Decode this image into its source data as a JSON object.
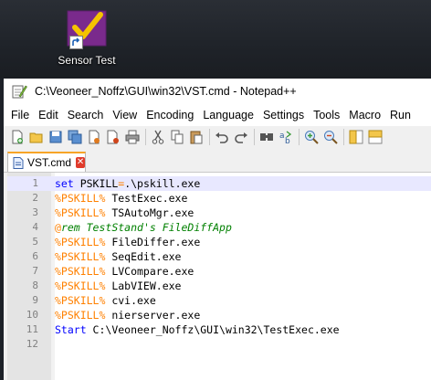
{
  "desktop": {
    "shortcut_label": "Sensor Test"
  },
  "window": {
    "title": "C:\\Veoneer_Noffz\\GUI\\win32\\VST.cmd - Notepad++"
  },
  "menubar": {
    "items": [
      "File",
      "Edit",
      "Search",
      "View",
      "Encoding",
      "Language",
      "Settings",
      "Tools",
      "Macro",
      "Run"
    ]
  },
  "toolbar": {
    "buttons": [
      "new-file-icon",
      "open-file-icon",
      "save-icon",
      "save-all-icon",
      "close-icon",
      "close-all-icon",
      "print-icon",
      "cut-icon",
      "copy-icon",
      "paste-icon",
      "undo-icon",
      "redo-icon",
      "find-icon",
      "replace-icon",
      "zoom-in-icon",
      "zoom-out-icon",
      "sync-vertical-icon",
      "sync-horizontal-icon"
    ]
  },
  "tabs": [
    {
      "label": "VST.cmd",
      "active": true
    }
  ],
  "editor": {
    "current_line": 1,
    "lines": [
      {
        "no": "1",
        "parts": [
          [
            "kw",
            "set"
          ],
          [
            "plain",
            " PSKILL"
          ],
          [
            "at",
            "="
          ],
          [
            "plain",
            ".\\pskill.exe"
          ]
        ]
      },
      {
        "no": "2",
        "parts": [
          [
            "var",
            "%PSKILL%"
          ],
          [
            "plain",
            " TestExec.exe"
          ]
        ]
      },
      {
        "no": "3",
        "parts": [
          [
            "var",
            "%PSKILL%"
          ],
          [
            "plain",
            " TSAutoMgr.exe"
          ]
        ]
      },
      {
        "no": "4",
        "parts": [
          [
            "at",
            "@"
          ],
          [
            "rem",
            "rem TestStand's FileDiffApp"
          ]
        ]
      },
      {
        "no": "5",
        "parts": [
          [
            "var",
            "%PSKILL%"
          ],
          [
            "plain",
            " FileDiffer.exe"
          ]
        ]
      },
      {
        "no": "6",
        "parts": [
          [
            "var",
            "%PSKILL%"
          ],
          [
            "plain",
            " SeqEdit.exe"
          ]
        ]
      },
      {
        "no": "7",
        "parts": [
          [
            "var",
            "%PSKILL%"
          ],
          [
            "plain",
            " LVCompare.exe"
          ]
        ]
      },
      {
        "no": "8",
        "parts": [
          [
            "var",
            "%PSKILL%"
          ],
          [
            "plain",
            " LabVIEW.exe"
          ]
        ]
      },
      {
        "no": "9",
        "parts": [
          [
            "var",
            "%PSKILL%"
          ],
          [
            "plain",
            " cvi.exe"
          ]
        ]
      },
      {
        "no": "10",
        "parts": [
          [
            "var",
            "%PSKILL%"
          ],
          [
            "plain",
            " nierserver.exe"
          ]
        ]
      },
      {
        "no": "11",
        "parts": [
          [
            "kw",
            "Start"
          ],
          [
            "plain",
            " C:\\Veoneer_Noffz\\GUI\\win32\\TestExec.exe"
          ]
        ]
      },
      {
        "no": "12",
        "parts": []
      }
    ]
  },
  "colors": {
    "keyword": "#0000ff",
    "variable": "#ff8000",
    "comment": "#008000",
    "tab_accent": "#f7a427",
    "current_line": "#e8e8ff"
  }
}
